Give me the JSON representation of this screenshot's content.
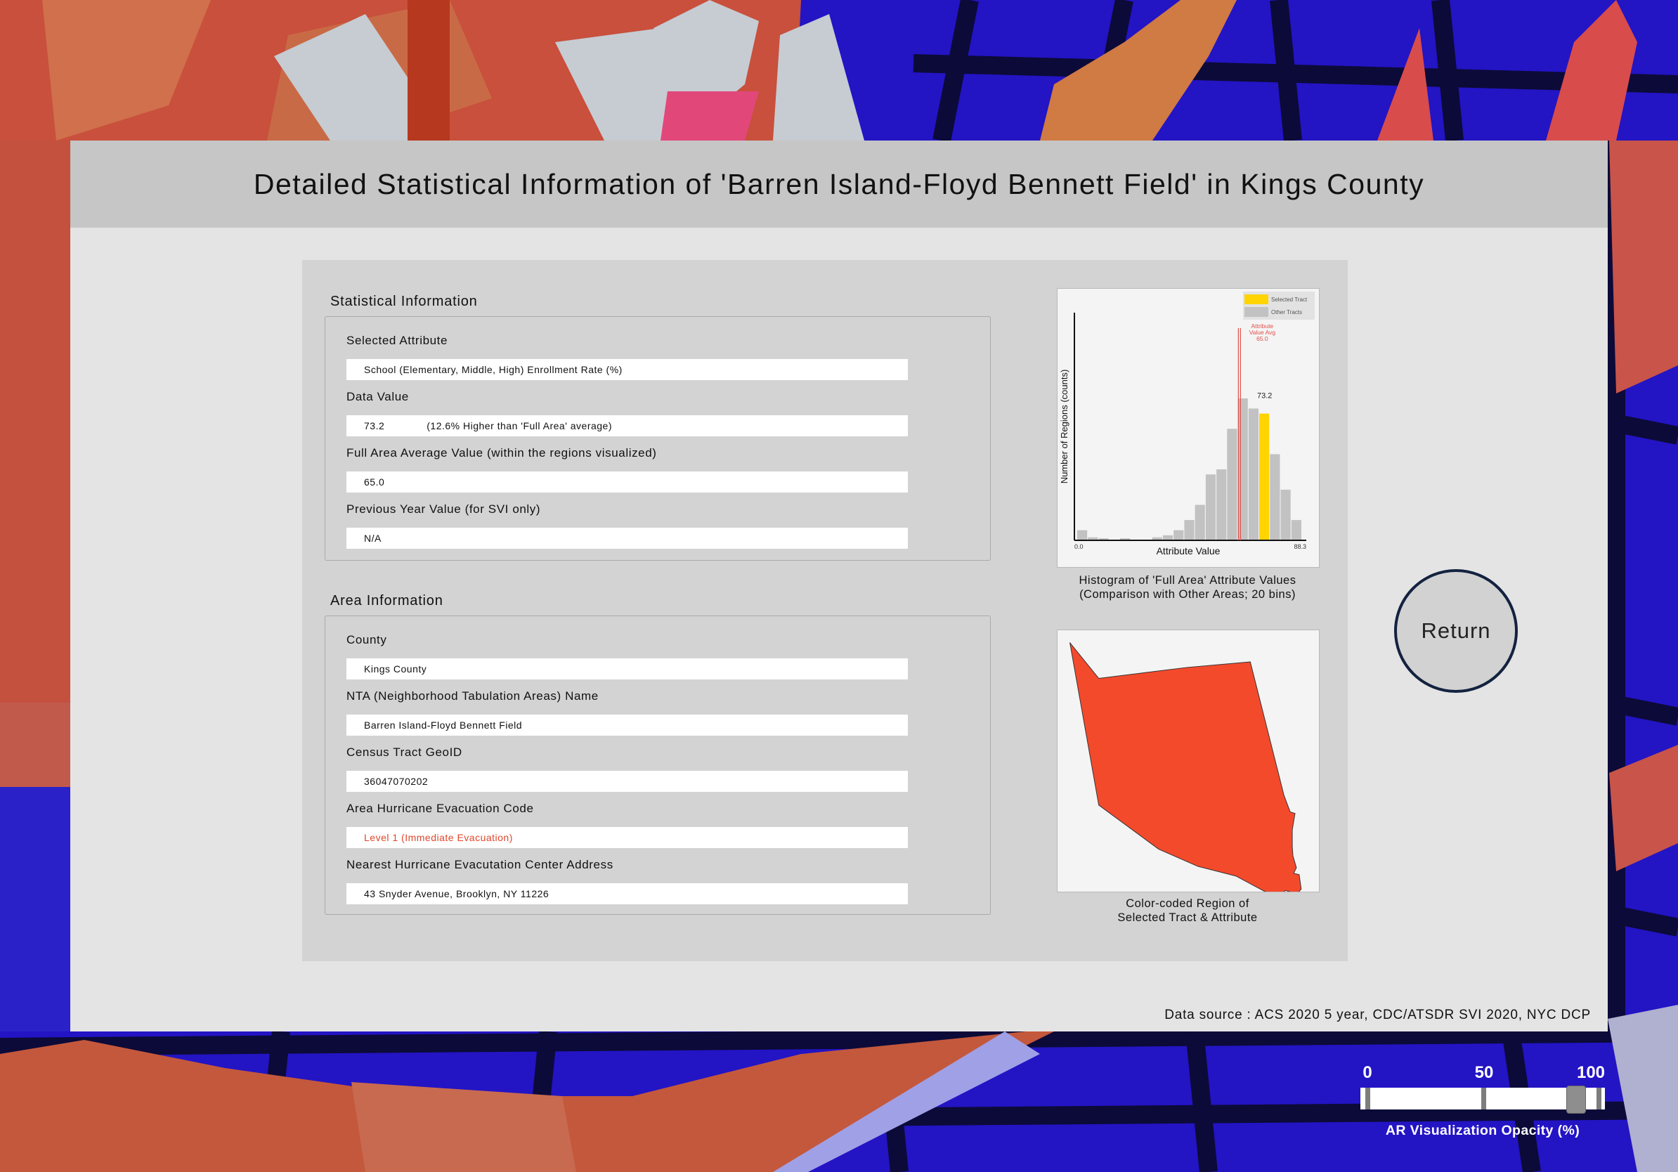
{
  "panel": {
    "title": "Detailed Statistical Information of 'Barren Island-Floyd Bennett Field' in Kings County",
    "data_source": "Data source : ACS 2020 5 year, CDC/ATSDR SVI 2020, NYC DCP"
  },
  "statistical_info": {
    "section_title": "Statistical Information",
    "selected_attribute_label": "Selected Attribute",
    "selected_attribute_value": "School (Elementary, Middle, High) Enrollment Rate (%)",
    "data_value_label": "Data Value",
    "data_value": "73.2",
    "data_value_note": "(12.6% Higher than 'Full Area' average)",
    "full_area_avg_label": "Full Area Average Value (within the regions visualized)",
    "full_area_avg_value": "65.0",
    "prev_year_label": "Previous Year Value (for SVI only)",
    "prev_year_value": "N/A"
  },
  "area_info": {
    "section_title": "Area Information",
    "county_label": "County",
    "county_value": "Kings County",
    "nta_label": "NTA (Neighborhood Tabulation Areas) Name",
    "nta_value": "Barren Island-Floyd Bennett Field",
    "geoid_label": "Census Tract GeoID",
    "geoid_value": "36047070202",
    "evac_code_label": "Area Hurricane Evacuation Code",
    "evac_code_value": "Level 1 (Immediate Evacuation)",
    "evac_center_label": "Nearest Hurricane Evacutation Center Address",
    "evac_center_value": "43 Snyder Avenue, Brooklyn, NY 11226"
  },
  "histogram": {
    "caption_line1": "Histogram of 'Full Area' Attribute Values",
    "caption_line2": "(Comparison with Other Areas; 20 bins)"
  },
  "chart_data": {
    "type": "bar",
    "xlabel": "Attribute Value",
    "ylabel": "Number of Regions (counts)",
    "x_min_label": "0.0",
    "x_max_label": "88.3",
    "xlim": [
      0.0,
      88.3
    ],
    "bins": 20,
    "values": [
      1,
      0.3,
      0.2,
      0,
      0.2,
      0,
      0,
      0.3,
      0.5,
      1,
      2,
      3.5,
      6.5,
      7,
      11,
      14,
      13,
      12.5,
      8.5,
      5,
      2
    ],
    "selected_bin_index": 17,
    "selected_label": "73.2",
    "average_value": 65.0,
    "average_label_lines": [
      "Attribute",
      "Value Avg",
      "65.0"
    ],
    "legend": [
      {
        "name": "Selected Tract",
        "color": "#ffd400"
      },
      {
        "name": "Other Tracts",
        "color": "#c2c2c2"
      }
    ],
    "colors": {
      "bar": "#c2c2c2",
      "selected": "#ffd400",
      "average_line": "#e0504a"
    }
  },
  "region_map": {
    "caption_line1": "Color-coded Region of",
    "caption_line2": "Selected Tract & Attribute",
    "fill_color": "#f44a2c"
  },
  "return_button": {
    "label": "Return"
  },
  "opacity_slider": {
    "ticks": [
      "0",
      "50",
      "100"
    ],
    "value_percent": 90,
    "caption": "AR Visualization Opacity (%)"
  }
}
